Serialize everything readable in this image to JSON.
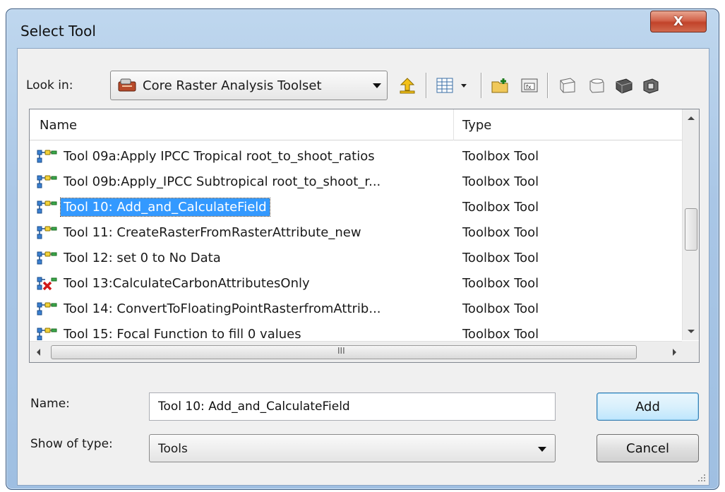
{
  "window": {
    "title": "Select Tool",
    "close_glyph": "X"
  },
  "look_in": {
    "label": "Look in:",
    "value": "Core Raster Analysis Toolset",
    "icon": "toolset-icon"
  },
  "toolbar": {
    "icons": [
      "up-one-level-icon",
      "view-menu-icon",
      "new-folder-icon",
      "connect-folder-icon",
      "catalog-icon",
      "toolbox-icon",
      "toolset-icon",
      "model-icon"
    ]
  },
  "list": {
    "columns": [
      "Name",
      "Type"
    ],
    "rows": [
      {
        "name": "Tool 09a:Apply IPCC Tropical root_to_shoot_ratios",
        "type": "Toolbox Tool",
        "icon": "model-tool-icon",
        "selected": false
      },
      {
        "name": "Tool 09b:Apply_IPCC Subtropical root_to_shoot_r...",
        "type": "Toolbox Tool",
        "icon": "model-tool-icon",
        "selected": false
      },
      {
        "name": "Tool 10: Add_and_CalculateField",
        "type": "Toolbox Tool",
        "icon": "model-tool-icon",
        "selected": true
      },
      {
        "name": "Tool 11: CreateRasterFromRasterAttribute_new",
        "type": "Toolbox Tool",
        "icon": "model-tool-icon",
        "selected": false
      },
      {
        "name": "Tool 12: set 0 to No Data",
        "type": "Toolbox Tool",
        "icon": "model-tool-icon",
        "selected": false
      },
      {
        "name": "Tool 13:CalculateCarbonAttributesOnly",
        "type": "Toolbox Tool",
        "icon": "model-tool-invalid-icon",
        "selected": false
      },
      {
        "name": "Tool 14: ConvertToFloatingPointRasterfromAttrib...",
        "type": "Toolbox Tool",
        "icon": "model-tool-icon",
        "selected": false
      },
      {
        "name": "Tool 15: Focal Function to fill 0 values",
        "type": "Toolbox Tool",
        "icon": "model-tool-icon",
        "selected": false
      }
    ],
    "hscroll_grip": "III"
  },
  "name_field": {
    "label": "Name:",
    "value": "Tool 10: Add_and_CalculateField"
  },
  "type_field": {
    "label": "Show of type:",
    "value": "Tools"
  },
  "buttons": {
    "add": "Add",
    "cancel": "Cancel"
  },
  "colors": {
    "selection": "#3399ff",
    "title_gradient": "#a9c6e6",
    "close_button": "#c1432a"
  }
}
